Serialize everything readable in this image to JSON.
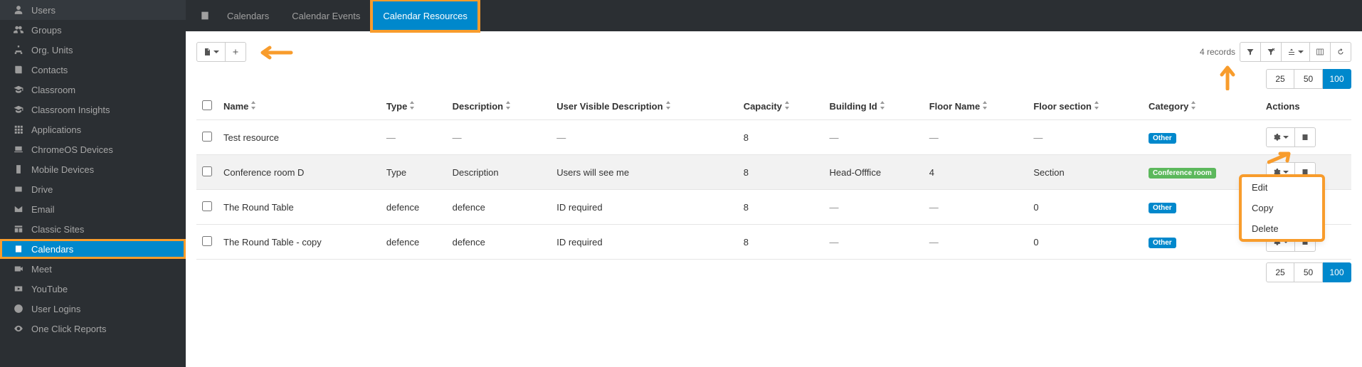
{
  "sidebar": {
    "items": [
      {
        "label": "Users",
        "icon": "user"
      },
      {
        "label": "Groups",
        "icon": "users"
      },
      {
        "label": "Org. Units",
        "icon": "sitemap"
      },
      {
        "label": "Contacts",
        "icon": "book"
      },
      {
        "label": "Classroom",
        "icon": "grad"
      },
      {
        "label": "Classroom Insights",
        "icon": "grad"
      },
      {
        "label": "Applications",
        "icon": "apps"
      },
      {
        "label": "ChromeOS Devices",
        "icon": "laptop"
      },
      {
        "label": "Mobile Devices",
        "icon": "phone"
      },
      {
        "label": "Drive",
        "icon": "drive"
      },
      {
        "label": "Email",
        "icon": "mail"
      },
      {
        "label": "Classic Sites",
        "icon": "site"
      },
      {
        "label": "Calendars",
        "icon": "calendar",
        "active": true,
        "highlight": true
      },
      {
        "label": "Meet",
        "icon": "video"
      },
      {
        "label": "YouTube",
        "icon": "yt"
      },
      {
        "label": "User Logins",
        "icon": "clock"
      },
      {
        "label": "One Click Reports",
        "icon": "eye"
      }
    ]
  },
  "topnav": {
    "items": [
      {
        "label": "",
        "icon_only": true
      },
      {
        "label": "Calendars"
      },
      {
        "label": "Calendar Events"
      },
      {
        "label": "Calendar Resources",
        "active": true,
        "highlight": true
      }
    ]
  },
  "toolbar": {
    "records_label": "4 records"
  },
  "pager": {
    "opt1": "25",
    "opt2": "50",
    "opt3": "100"
  },
  "table": {
    "columns": [
      "Name",
      "Type",
      "Description",
      "User Visible Description",
      "Capacity",
      "Building Id",
      "Floor Name",
      "Floor section",
      "Category",
      "Actions"
    ],
    "rows": [
      {
        "name": "Test resource",
        "type": "—",
        "desc": "—",
        "uvd": "—",
        "cap": "8",
        "bid": "—",
        "fname": "—",
        "fsec": "—",
        "cat": "Other",
        "cat_class": "other"
      },
      {
        "name": "Conference room D",
        "type": "Type",
        "desc": "Description",
        "uvd": "Users will see me",
        "cap": "8",
        "bid": "Head-Offfice",
        "fname": "4",
        "fsec": "Section",
        "cat": "Conference room",
        "cat_class": "conference",
        "hover": true,
        "dropdown": true
      },
      {
        "name": "The Round Table",
        "type": "defence",
        "desc": "defence",
        "uvd": "ID required",
        "cap": "8",
        "bid": "—",
        "fname": "—",
        "fsec": "0",
        "cat": "Other",
        "cat_class": "other"
      },
      {
        "name": "The Round Table - copy",
        "type": "defence",
        "desc": "defence",
        "uvd": "ID required",
        "cap": "8",
        "bid": "—",
        "fname": "—",
        "fsec": "0",
        "cat": "Other",
        "cat_class": "other"
      }
    ]
  },
  "dropdown": {
    "items": [
      "Edit",
      "Copy",
      "Delete"
    ]
  }
}
